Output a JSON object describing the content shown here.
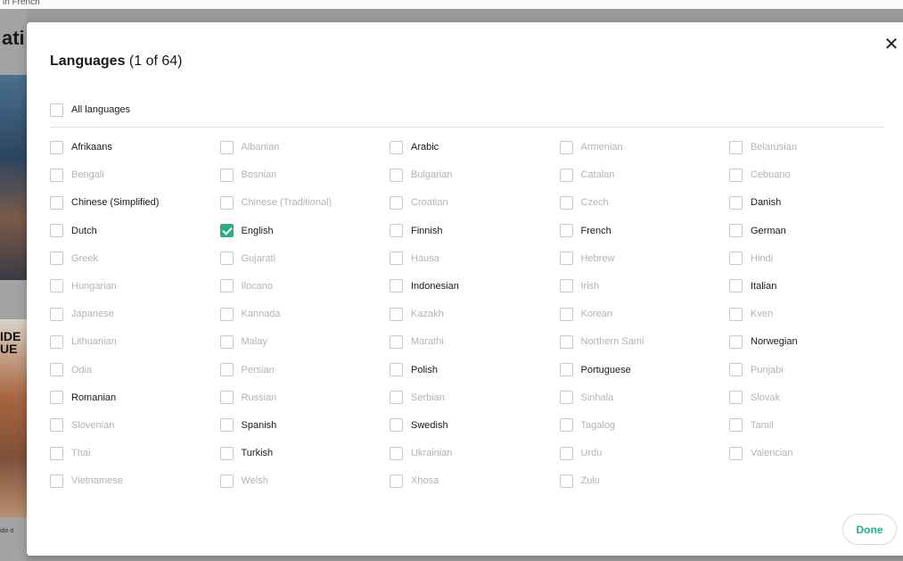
{
  "background": {
    "top_text": "in French",
    "heading": "ati",
    "image_text": "IDE\nUE",
    "caption": "ide d"
  },
  "modal": {
    "title": "Languages",
    "count": "(1 of 64)",
    "close_icon": "close-icon",
    "all_languages": {
      "label": "All languages",
      "checked": false
    },
    "done_label": "Done",
    "accent_color": "#27b27a"
  },
  "languages": [
    {
      "label": "Afrikaans",
      "checked": false,
      "available": true
    },
    {
      "label": "Albanian",
      "checked": false,
      "available": false
    },
    {
      "label": "Arabic",
      "checked": false,
      "available": true
    },
    {
      "label": "Armenian",
      "checked": false,
      "available": false
    },
    {
      "label": "Belarusian",
      "checked": false,
      "available": false
    },
    {
      "label": "Bengali",
      "checked": false,
      "available": false
    },
    {
      "label": "Bosnian",
      "checked": false,
      "available": false
    },
    {
      "label": "Bulgarian",
      "checked": false,
      "available": false
    },
    {
      "label": "Catalan",
      "checked": false,
      "available": false
    },
    {
      "label": "Cebuano",
      "checked": false,
      "available": false
    },
    {
      "label": "Chinese (Simplified)",
      "checked": false,
      "available": true
    },
    {
      "label": "Chinese (Traditional)",
      "checked": false,
      "available": false
    },
    {
      "label": "Croatian",
      "checked": false,
      "available": false
    },
    {
      "label": "Czech",
      "checked": false,
      "available": false
    },
    {
      "label": "Danish",
      "checked": false,
      "available": true
    },
    {
      "label": "Dutch",
      "checked": false,
      "available": true
    },
    {
      "label": "English",
      "checked": true,
      "available": true
    },
    {
      "label": "Finnish",
      "checked": false,
      "available": true
    },
    {
      "label": "French",
      "checked": false,
      "available": true
    },
    {
      "label": "German",
      "checked": false,
      "available": true
    },
    {
      "label": "Greek",
      "checked": false,
      "available": false
    },
    {
      "label": "Gujarati",
      "checked": false,
      "available": false
    },
    {
      "label": "Hausa",
      "checked": false,
      "available": false
    },
    {
      "label": "Hebrew",
      "checked": false,
      "available": false
    },
    {
      "label": "Hindi",
      "checked": false,
      "available": false
    },
    {
      "label": "Hungarian",
      "checked": false,
      "available": false
    },
    {
      "label": "Ilocano",
      "checked": false,
      "available": false
    },
    {
      "label": "Indonesian",
      "checked": false,
      "available": true
    },
    {
      "label": "Irish",
      "checked": false,
      "available": false
    },
    {
      "label": "Italian",
      "checked": false,
      "available": true
    },
    {
      "label": "Japanese",
      "checked": false,
      "available": false
    },
    {
      "label": "Kannada",
      "checked": false,
      "available": false
    },
    {
      "label": "Kazakh",
      "checked": false,
      "available": false
    },
    {
      "label": "Korean",
      "checked": false,
      "available": false
    },
    {
      "label": "Kven",
      "checked": false,
      "available": false
    },
    {
      "label": "Lithuanian",
      "checked": false,
      "available": false
    },
    {
      "label": "Malay",
      "checked": false,
      "available": false
    },
    {
      "label": "Marathi",
      "checked": false,
      "available": false
    },
    {
      "label": "Northern Sami",
      "checked": false,
      "available": false
    },
    {
      "label": "Norwegian",
      "checked": false,
      "available": true
    },
    {
      "label": "Odia",
      "checked": false,
      "available": false
    },
    {
      "label": "Persian",
      "checked": false,
      "available": false
    },
    {
      "label": "Polish",
      "checked": false,
      "available": true
    },
    {
      "label": "Portuguese",
      "checked": false,
      "available": true
    },
    {
      "label": "Punjabi",
      "checked": false,
      "available": false
    },
    {
      "label": "Romanian",
      "checked": false,
      "available": true
    },
    {
      "label": "Russian",
      "checked": false,
      "available": false
    },
    {
      "label": "Serbian",
      "checked": false,
      "available": false
    },
    {
      "label": "Sinhala",
      "checked": false,
      "available": false
    },
    {
      "label": "Slovak",
      "checked": false,
      "available": false
    },
    {
      "label": "Slovenian",
      "checked": false,
      "available": false
    },
    {
      "label": "Spanish",
      "checked": false,
      "available": true
    },
    {
      "label": "Swedish",
      "checked": false,
      "available": true
    },
    {
      "label": "Tagalog",
      "checked": false,
      "available": false
    },
    {
      "label": "Tamil",
      "checked": false,
      "available": false
    },
    {
      "label": "Thai",
      "checked": false,
      "available": false
    },
    {
      "label": "Turkish",
      "checked": false,
      "available": true
    },
    {
      "label": "Ukrainian",
      "checked": false,
      "available": false
    },
    {
      "label": "Urdu",
      "checked": false,
      "available": false
    },
    {
      "label": "Valencian",
      "checked": false,
      "available": false
    },
    {
      "label": "Vietnamese",
      "checked": false,
      "available": false
    },
    {
      "label": "Welsh",
      "checked": false,
      "available": false
    },
    {
      "label": "Xhosa",
      "checked": false,
      "available": false
    },
    {
      "label": "Zulu",
      "checked": false,
      "available": false
    }
  ]
}
